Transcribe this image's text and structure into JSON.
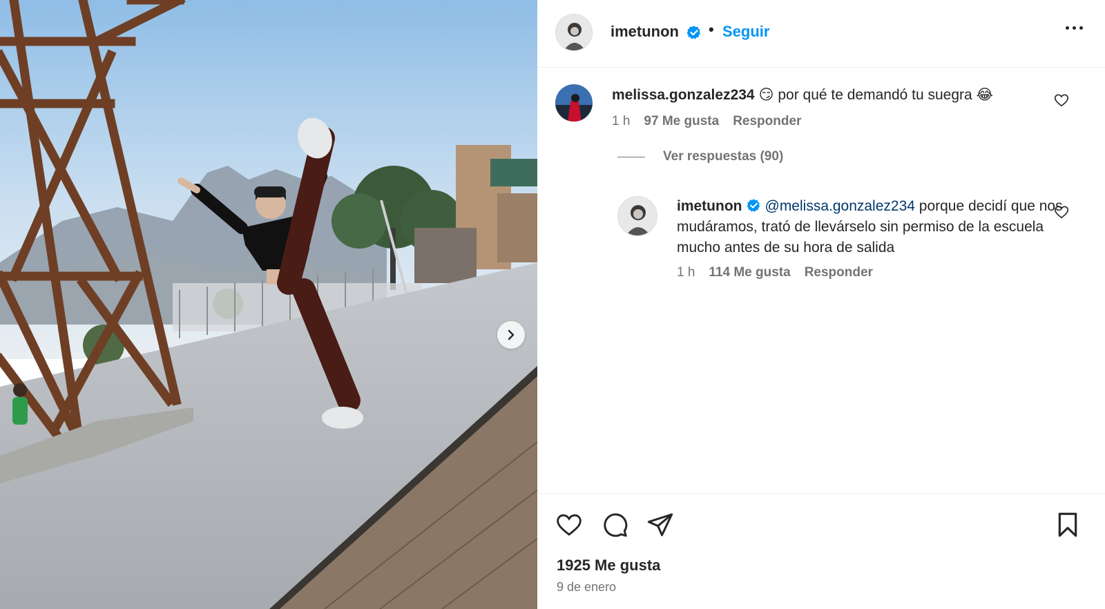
{
  "colors": {
    "accent": "#0095f6",
    "text_primary": "#262626",
    "text_secondary": "#737373",
    "mention": "#00376b",
    "divider": "#efefef"
  },
  "post": {
    "media_icon": "chevron-right-icon"
  },
  "header": {
    "username": "imetunon",
    "verified_icon": "verified-badge-icon",
    "separator": "•",
    "follow_label": "Seguir",
    "more_icon": "more-horizontal-icon"
  },
  "comments": [
    {
      "author": "melissa.gonzalez234",
      "text": "😏 por qué te demandó tu suegra 😂",
      "time": "1 h",
      "likes": "97 Me gusta",
      "reply_label": "Responder",
      "view_replies": "Ver respuestas (90)"
    }
  ],
  "reply": {
    "author": "imetunon",
    "mention": "@melissa.gonzalez234",
    "text": "porque decidí que nos mudáramos, trató de llevárselo sin permiso de la escuela mucho antes de su hora de salida",
    "time": "1 h",
    "likes": "114 Me gusta",
    "reply_label": "Responder"
  },
  "footer": {
    "likes": "1925 Me gusta",
    "date": "9 de enero",
    "icons": [
      "heart-icon",
      "comment-icon",
      "share-icon",
      "bookmark-icon"
    ]
  }
}
